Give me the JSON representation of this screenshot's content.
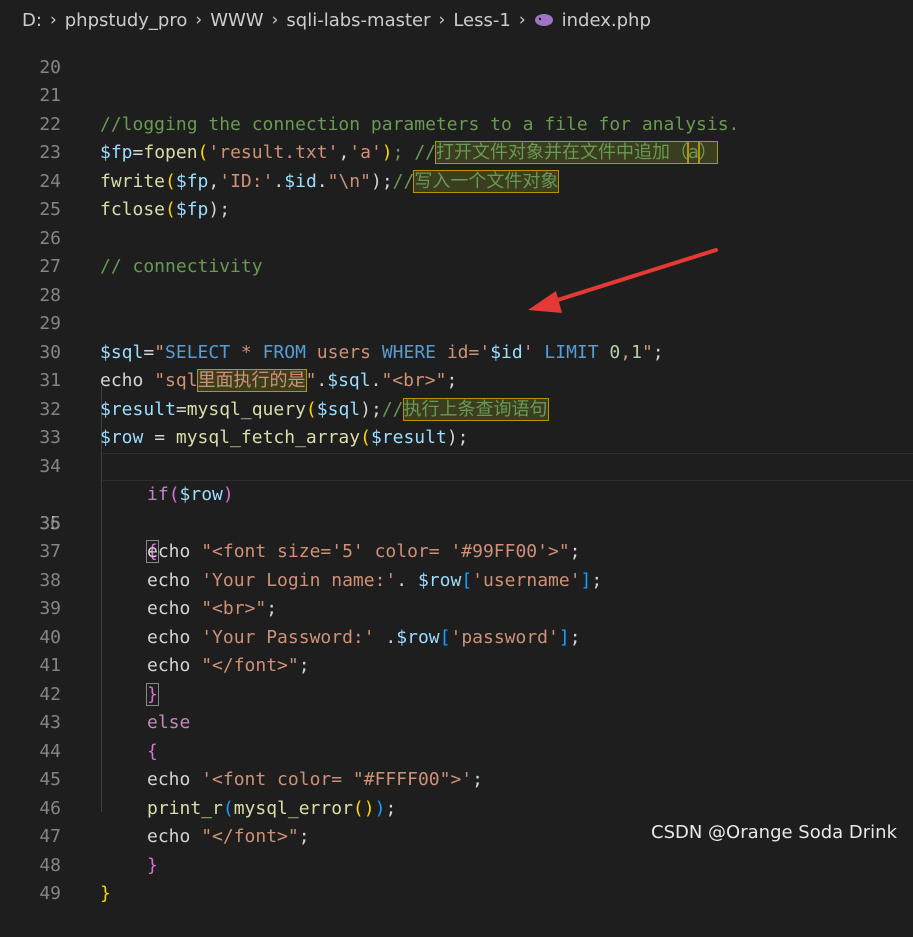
{
  "breadcrumb": {
    "drive": "D:",
    "folder1": "phpstudy_pro",
    "folder2": "WWW",
    "folder3": "sqli-labs-master",
    "folder4": "Less-1",
    "file": "index.php"
  },
  "lines": {
    "l20": "20",
    "l21": "21",
    "c21": "//logging the connection parameters to a file for analysis.",
    "l22": "22",
    "c22_a": "$fp",
    "c22_b": "=",
    "c22_c": "fopen",
    "c22_d": "(",
    "c22_e": "'result.txt'",
    "c22_f": ",",
    "c22_g": "'a'",
    "c22_h": ")",
    "c22_i": "; //",
    "c22_j": "打开文件对象并在文件中追加（",
    "c22_k": "a",
    "c22_l": "）",
    "l23": "23",
    "c23_a": "fwrite",
    "c23_b": "(",
    "c23_c": "$fp",
    "c23_d": ",",
    "c23_e": "'ID:'",
    "c23_f": ".",
    "c23_g": "$id",
    "c23_h": ".",
    "c23_i": "\"\\n\"",
    "c23_j": ");",
    "c23_k": "//",
    "c23_l": "写入一个文件对象",
    "l24": "24",
    "c24_a": "fclose",
    "c24_b": "(",
    "c24_c": "$fp",
    "c24_d": ");",
    "l25": "25",
    "l26": "26",
    "c26": "// connectivity",
    "l27": "27",
    "l28": "28",
    "l29": "29",
    "c29_a": "$sql",
    "c29_b": "=",
    "c29_c": "\"",
    "c29_d": "SELECT",
    "c29_e": " * ",
    "c29_f": "FROM",
    "c29_g": " users ",
    "c29_h": "WHERE",
    "c29_i": " id='",
    "c29_j": "$id",
    "c29_k": "' ",
    "c29_l": "LIMIT",
    "c29_m": " ",
    "c29_n": "0",
    "c29_o": ",",
    "c29_p": "1",
    "c29_q": "\"",
    "c29_r": ";",
    "l30": "30",
    "c30_a": "echo",
    "c30_b": " ",
    "c30_c": "\"sql",
    "c30_d": "里面执行的是",
    "c30_e": "\"",
    "c30_f": ".",
    "c30_g": "$sql",
    "c30_h": ".",
    "c30_i": "\"<br>\"",
    "c30_j": ";",
    "l31": "31",
    "c31_a": "$result",
    "c31_b": "=",
    "c31_c": "mysql_query",
    "c31_d": "(",
    "c31_e": "$sql",
    "c31_f": ");",
    "c31_g": "//",
    "c31_h": "执行上条查询语句",
    "l32": "32",
    "c32_a": "$row",
    "c32_b": " = ",
    "c32_c": "mysql_fetch_array",
    "c32_d": "(",
    "c32_e": "$result",
    "c32_f": ");",
    "l33": "33",
    "l34": "34",
    "c34_a": "if",
    "c34_b": "(",
    "c34_c": "$row",
    "c34_d": ")",
    "l35": "35",
    "c35_a": "{",
    "l36": "36",
    "c36_a": "echo",
    "c36_b": " ",
    "c36_c": "\"<font size='5' color= '#99FF00'>\"",
    "c36_d": ";",
    "l37": "37",
    "c37_a": "echo",
    "c37_b": " ",
    "c37_c": "'Your Login name:'",
    "c37_d": ". ",
    "c37_e": "$row",
    "c37_f": "[",
    "c37_g": "'username'",
    "c37_h": "]",
    "c37_i": ";",
    "l38": "38",
    "c38_a": "echo",
    "c38_b": " ",
    "c38_c": "\"<br>\"",
    "c38_d": ";",
    "l39": "39",
    "c39_a": "echo",
    "c39_b": " ",
    "c39_c": "'Your Password:'",
    "c39_d": " .",
    "c39_e": "$row",
    "c39_f": "[",
    "c39_g": "'password'",
    "c39_h": "]",
    "c39_i": ";",
    "l40": "40",
    "c40_a": "echo",
    "c40_b": " ",
    "c40_c": "\"</font>\"",
    "c40_d": ";",
    "l41": "41",
    "c41_a": "}",
    "l42": "42",
    "c42_a": "else",
    "l43": "43",
    "c43_a": "{",
    "l44": "44",
    "c44_a": "echo",
    "c44_b": " ",
    "c44_c": "'<font color= \"#FFFF00\">'",
    "c44_d": ";",
    "l45": "45",
    "c45_a": "print_r",
    "c45_b": "(",
    "c45_c": "mysql_error",
    "c45_d": "()",
    "c45_e": ")",
    "c45_f": ";",
    "l46": "46",
    "c46_a": "echo",
    "c46_b": " ",
    "c46_c": "\"</font>\"",
    "c46_d": ";",
    "l47": "47",
    "c47_a": "}",
    "l48": "48",
    "c48_a": "}",
    "l49": "49"
  },
  "watermark": "CSDN @Orange Soda Drink",
  "colors": {
    "arrow": "#e53935",
    "highlight_border": "#b89500"
  }
}
